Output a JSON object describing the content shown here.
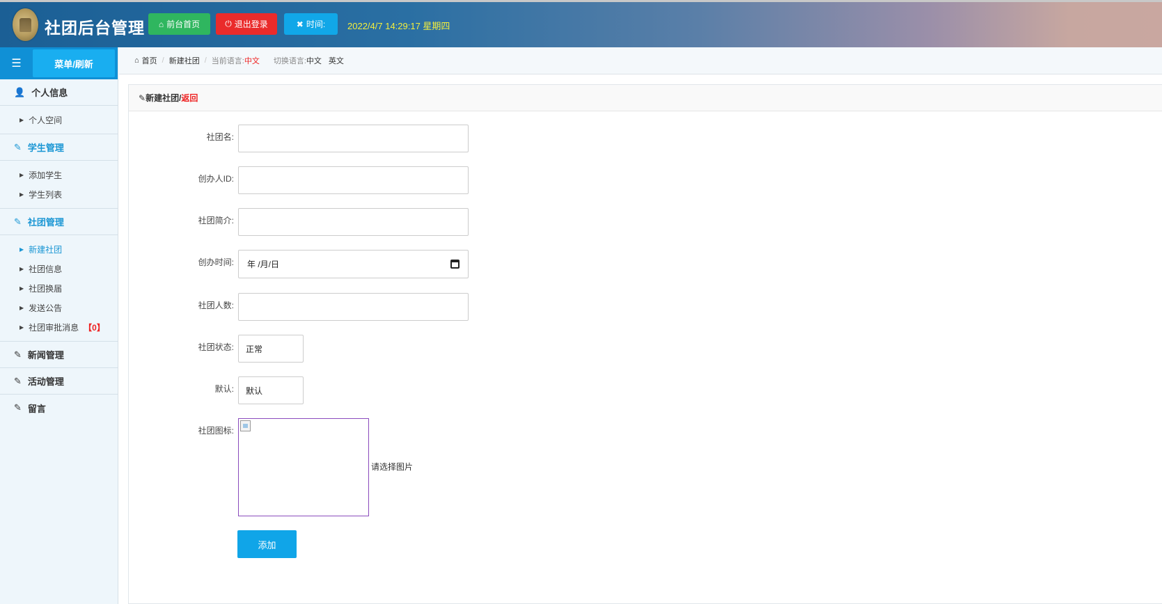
{
  "header": {
    "title": "社团后台管理",
    "home_label": "前台首页",
    "logout_label": "退出登录",
    "time_label": "时间:",
    "clock": "2022/4/7 14:29:17 星期四"
  },
  "sidebar": {
    "refresh_label": "菜单/刷新",
    "sections": [
      {
        "label": "个人信息",
        "icon": "user-icon",
        "items": [
          "个人空间"
        ]
      },
      {
        "label": "学生管理",
        "icon": "edit-icon",
        "items": [
          "添加学生",
          "学生列表"
        ]
      },
      {
        "label": "社团管理",
        "icon": "edit-icon",
        "items": [
          "新建社团",
          "社团信息",
          "社团换届",
          "发送公告",
          "社团审批消息"
        ],
        "badge": "【0】"
      },
      {
        "label": "新闻管理",
        "icon": "edit-icon"
      },
      {
        "label": "活动管理",
        "icon": "edit-icon"
      },
      {
        "label": "留言",
        "icon": "edit-icon"
      }
    ]
  },
  "breadcrumb": {
    "home": "首页",
    "current": "新建社团",
    "lang_label": "当前语言:",
    "lang_value": "中文",
    "switch_label": "切换语言:",
    "switch_zh": "中文",
    "switch_en": "英文"
  },
  "panel": {
    "title": "新建社团/",
    "back": "返回"
  },
  "form": {
    "name_label": "社团名:",
    "founder_label": "创办人ID:",
    "intro_label": "社团简介:",
    "date_label": "创办时间:",
    "date_placeholder": "年 /月/日",
    "count_label": "社团人数:",
    "status_label": "社团状态:",
    "status_value": "正常",
    "default_label": "默认:",
    "default_value": "默认",
    "icon_label": "社团图标:",
    "icon_hint": "请选择图片",
    "submit_label": "添加"
  },
  "colors": {
    "primary": "#10a5e8",
    "success": "#2fb65f",
    "danger": "#ea2b2b",
    "clock": "#f4ee3c"
  }
}
